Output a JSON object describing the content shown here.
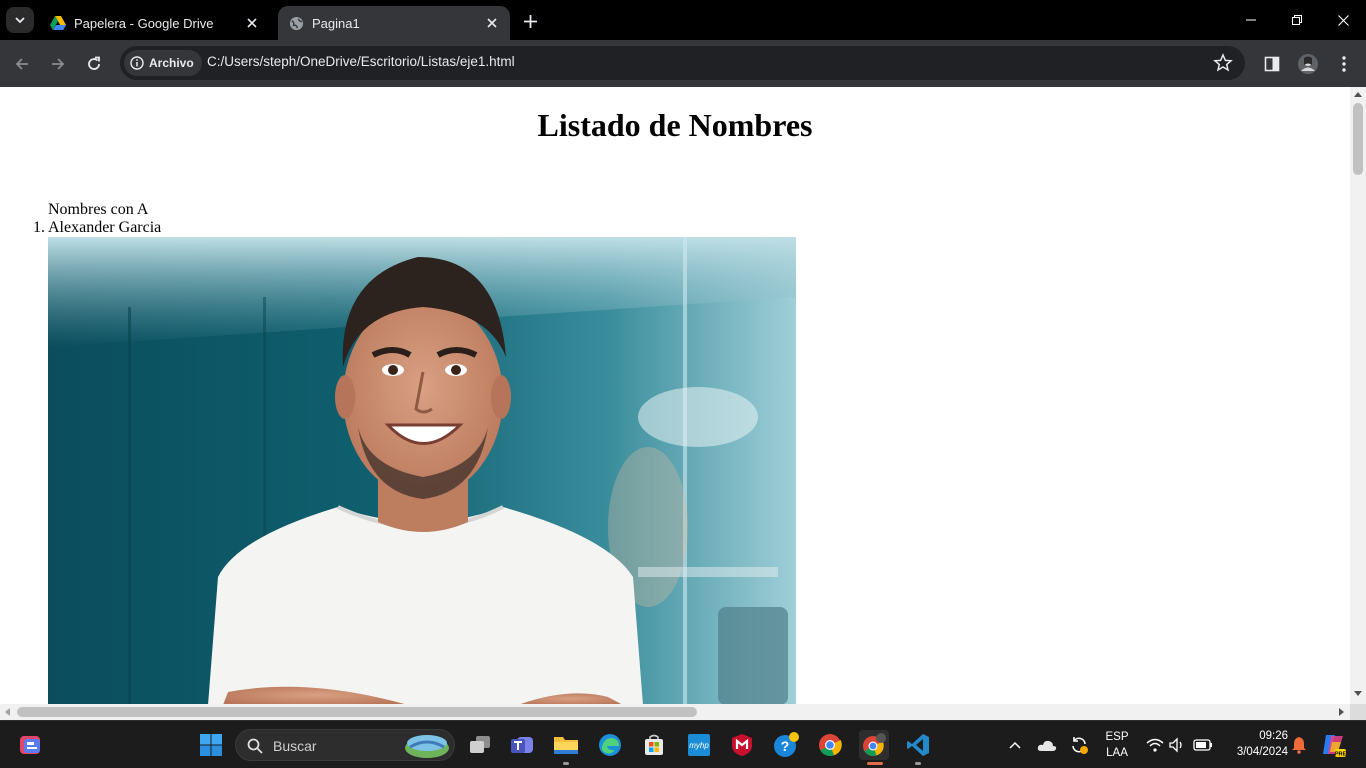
{
  "browser": {
    "tabs": [
      {
        "title": "Papelera - Google Drive",
        "icon": "google-drive-icon",
        "active": false
      },
      {
        "title": "Pagina1",
        "icon": "globe-icon",
        "active": true
      }
    ],
    "omnibox": {
      "security_chip": "Archivo",
      "url": "C:/Users/steph/OneDrive/Escritorio/Listas/eje1.html"
    }
  },
  "page": {
    "heading": "Listado de Nombres",
    "list_title": "Nombres con A",
    "items": [
      {
        "number": "1.",
        "name": "Alexander Garcia",
        "image": "portrait-photo"
      }
    ]
  },
  "taskbar": {
    "search_placeholder": "Buscar",
    "language": "ESP",
    "layout": "LAA",
    "time": "09:26",
    "date": "3/04/2024"
  },
  "colors": {
    "titlebar": "#000000",
    "toolbar": "#35363a",
    "omnibox": "#202124",
    "taskbar": "#1c1c1c"
  }
}
